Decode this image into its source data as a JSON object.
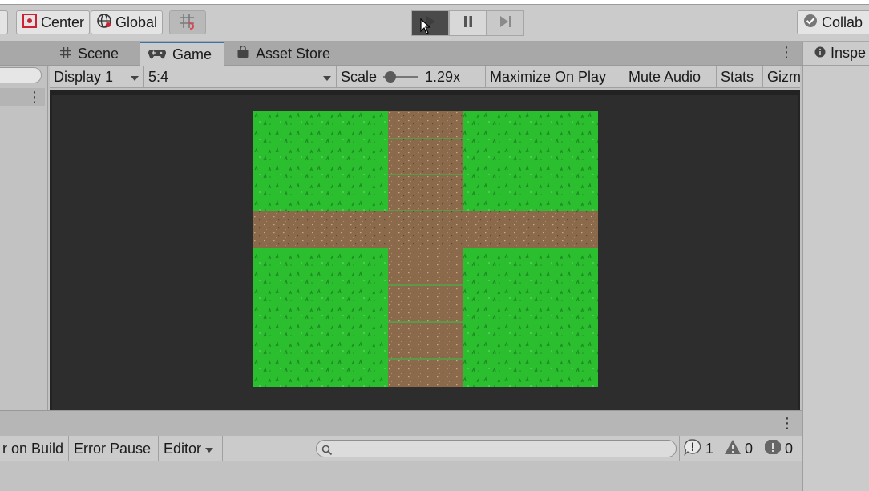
{
  "toolbar": {
    "pivot_label": "Center",
    "space_label": "Global",
    "collab_label": "Collab"
  },
  "tabs": [
    {
      "label": "Scene",
      "icon": "grid-icon"
    },
    {
      "label": "Game",
      "icon": "gamepad-icon"
    },
    {
      "label": "Asset Store",
      "icon": "shopping-bag-icon"
    }
  ],
  "inspector": {
    "label": "Inspe"
  },
  "game_controls": {
    "display": "Display 1",
    "aspect": "5:4",
    "scale_label": "Scale",
    "scale_value": "1.29x",
    "scale_fraction": 0.05,
    "maximize": "Maximize On Play",
    "mute": "Mute Audio",
    "stats": "Stats",
    "gizmos": "Gizm"
  },
  "console": {
    "clear_on_build": "r on Build",
    "error_pause": "Error Pause",
    "editor": "Editor",
    "search_placeholder": "",
    "log_count": "1",
    "warning_count": "0",
    "error_count": "0"
  },
  "colors": {
    "grass": "#2bbf30",
    "dirt": "#8a6a4a",
    "play_active": "#4a4a4a",
    "tab_accent": "#3a72b0"
  }
}
